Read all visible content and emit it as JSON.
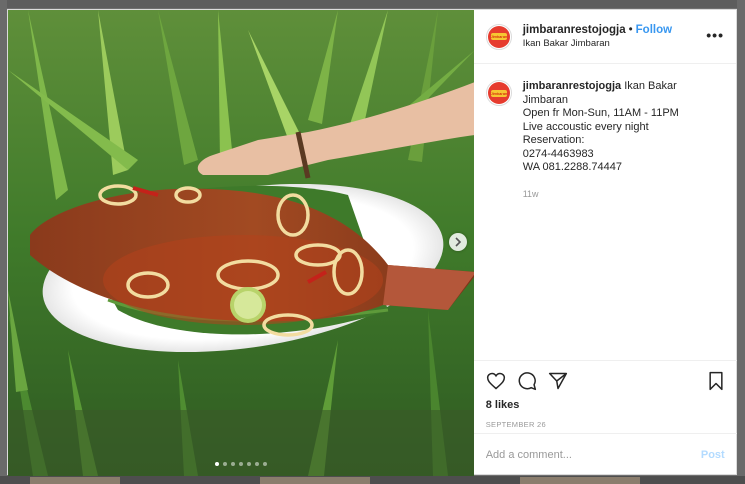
{
  "post": {
    "username": "jimbaranrestojogja",
    "follow_label": "Follow",
    "bullet": "•",
    "location": "Ikan Bakar Jimbaran",
    "more_label": "•••",
    "avatar_text": "Jimbaran"
  },
  "caption": {
    "username": "jimbaranrestojogja",
    "lines": [
      "Ikan Bakar",
      "Jimbaran",
      "Open fr Mon-Sun, 11AM - 11PM",
      "Live accoustic every night",
      "Reservation:",
      "0274-4463983",
      "WA 081.2288.74447"
    ],
    "time": "11w"
  },
  "actions": {
    "icons": [
      "heart-icon",
      "comment-icon",
      "share-icon",
      "bookmark-icon"
    ],
    "likes": "8 likes",
    "date": "SEPTEMBER 26"
  },
  "comment": {
    "placeholder": "Add a comment...",
    "post_label": "Post"
  },
  "carousel": {
    "dot_count": 7,
    "active_index": 0
  },
  "colors": {
    "link_blue": "#3897f0",
    "post_disabled": "#b3dbff",
    "brand_red": "#e63b2e",
    "brand_yellow": "#f6c532"
  }
}
